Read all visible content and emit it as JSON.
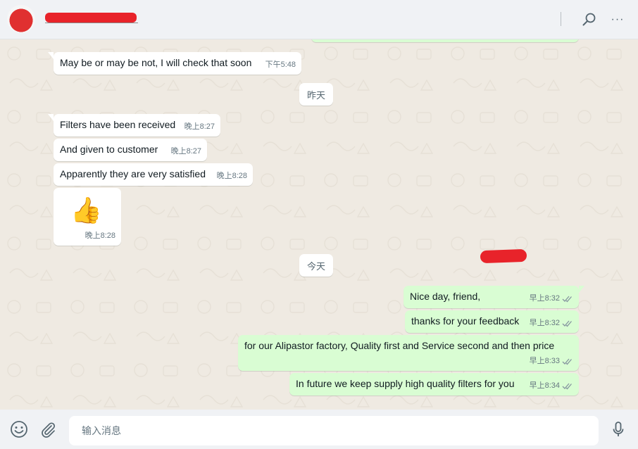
{
  "header": {
    "more_label": "···"
  },
  "chat": {
    "messages": [
      {
        "text": "May be or may be not, I will check that soon",
        "time": "下午5:48"
      },
      {
        "text": "Filters have been received",
        "time": "晚上8:27"
      },
      {
        "text": "And given to customer",
        "time": "晚上8:27"
      },
      {
        "text": "Apparently they are very satisfied",
        "time": "晚上8:28"
      },
      {
        "emoji": "👍",
        "time": "晚上8:28"
      },
      {
        "text": "Nice day, friend,",
        "time": "早上8:32"
      },
      {
        "text": "thanks for your feedback",
        "time": "早上8:32"
      },
      {
        "text": "for our Alipastor factory, Quality first and Service second and then price",
        "time": "早上8:33"
      },
      {
        "text": "In future we keep supply high quality filters for you",
        "time": "早上8:34"
      }
    ],
    "dividers": {
      "yesterday": "昨天",
      "today": "今天"
    }
  },
  "composer": {
    "placeholder": "输入消息"
  },
  "colors": {
    "incoming": "#ffffff",
    "outgoing": "#d9fdd3",
    "background": "#efeae2",
    "read_tick": "#8696a0"
  },
  "icons": [
    "search-icon",
    "more-icon",
    "emoji-icon",
    "attach-icon",
    "mic-icon",
    "double-check-icon"
  ]
}
